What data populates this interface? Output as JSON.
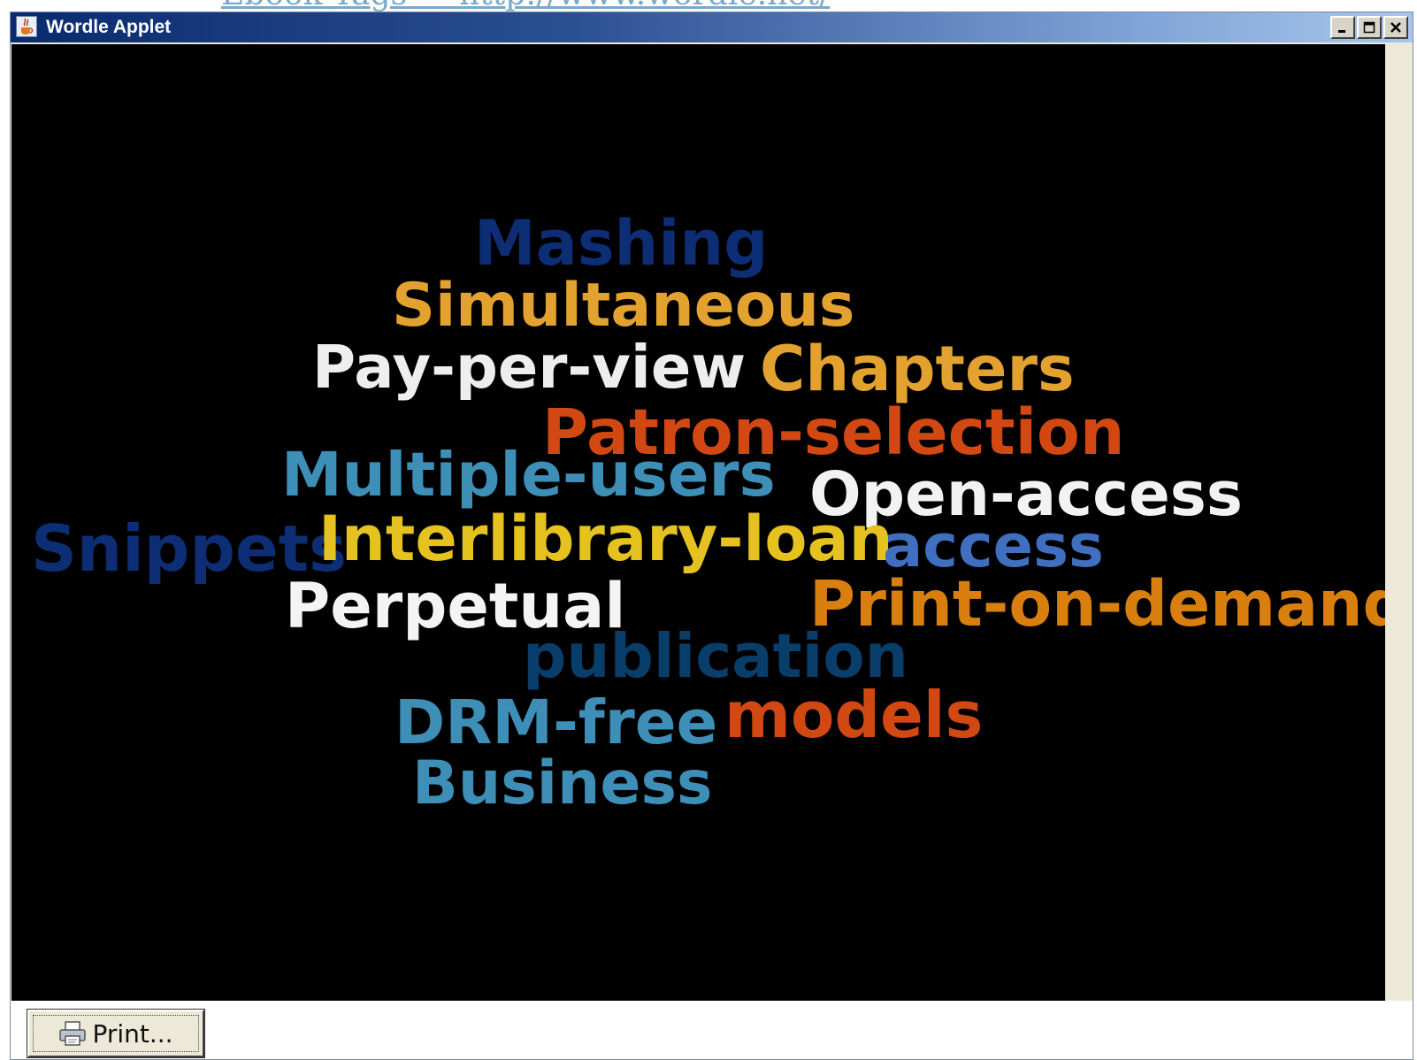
{
  "page": {
    "link_text": "Ebook Tags — http://www.wordle.net/"
  },
  "window": {
    "title": "Wordle Applet",
    "icon": "java-cup-icon",
    "controls": [
      "minimize-icon",
      "maximize-icon",
      "close-icon"
    ]
  },
  "canvas": {
    "background": "#000000"
  },
  "words": [
    {
      "text": "Mashing",
      "color": "#0d2d74"
    },
    {
      "text": "Simultaneous",
      "color": "#e3a22f"
    },
    {
      "text": "Pay-per-view",
      "color": "#eeeeee"
    },
    {
      "text": "Chapters",
      "color": "#e3a22f"
    },
    {
      "text": "Patron-selection",
      "color": "#d24812"
    },
    {
      "text": "Multiple-users",
      "color": "#3d8fb8"
    },
    {
      "text": "Open-access",
      "color": "#f2f2f2"
    },
    {
      "text": "Snippets",
      "color": "#0d2d74"
    },
    {
      "text": "Interlibrary-loan",
      "color": "#e5c21f"
    },
    {
      "text": "access",
      "color": "#3f6fbe"
    },
    {
      "text": "Perpetual",
      "color": "#f4f4f4"
    },
    {
      "text": "Print-on-demand",
      "color": "#d97f0f"
    },
    {
      "text": "publication",
      "color": "#093e6b"
    },
    {
      "text": "DRM-free",
      "color": "#3d8fb8"
    },
    {
      "text": "models",
      "color": "#d24812"
    },
    {
      "text": "Business",
      "color": "#3d8fb8"
    }
  ],
  "toolbar": {
    "print_label": "Print...",
    "print_icon": "printer-icon"
  }
}
